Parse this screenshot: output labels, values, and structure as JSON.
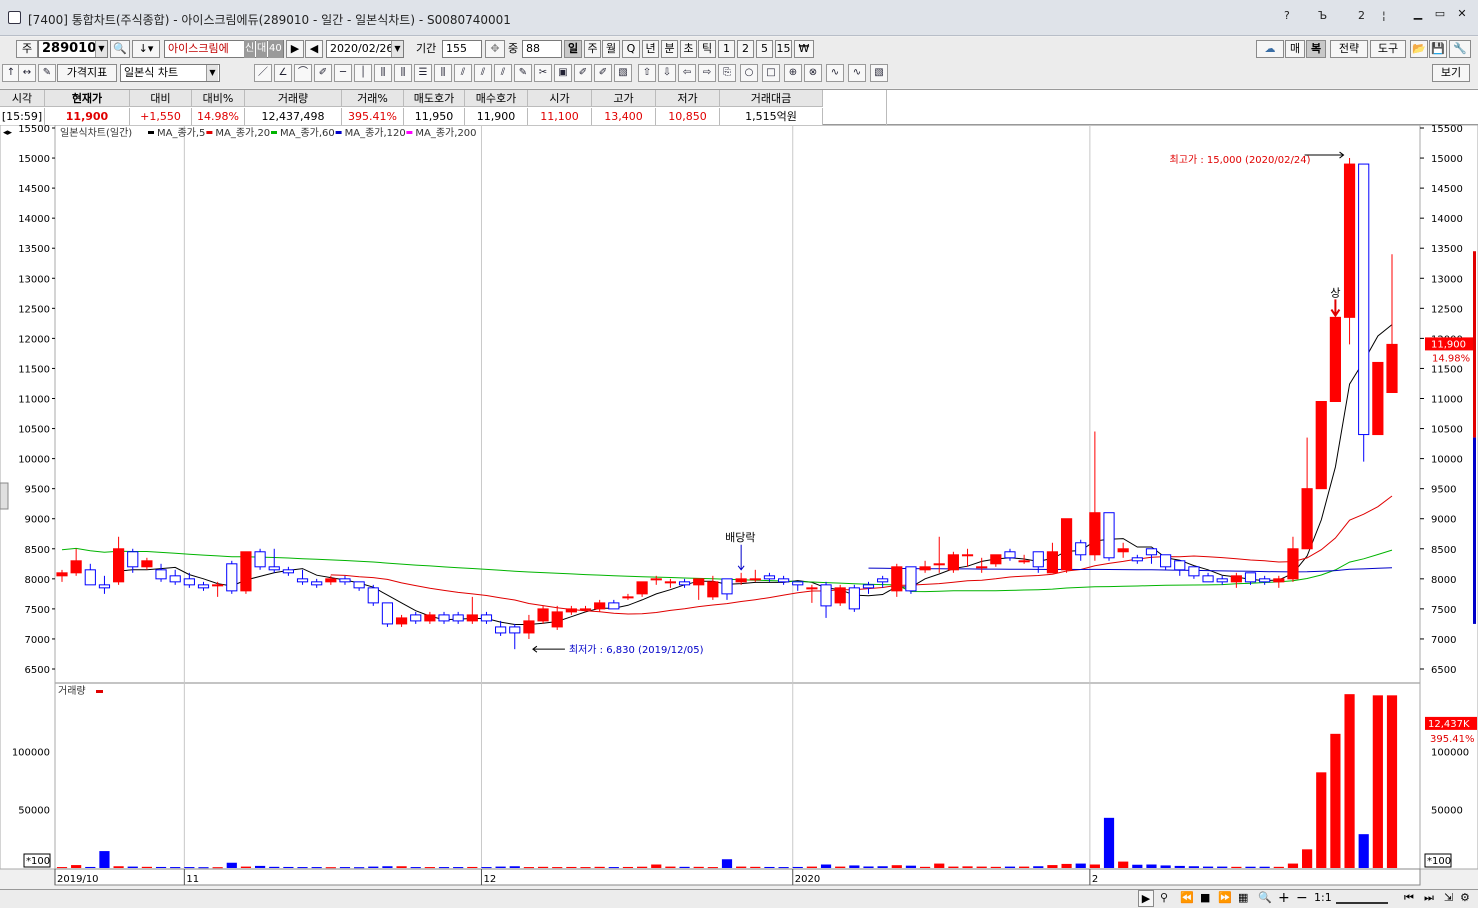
{
  "window": {
    "title": "[7400] 통합차트(주식종합) - 아이스크림에듀(289010 - 일간 - 일본식차트) - S0080740001",
    "controls": [
      "?",
      "Ъ",
      "2",
      "¦"
    ]
  },
  "toolbar1": {
    "market_prefix": "주",
    "code": "289010",
    "stock_name": "아이스크림에",
    "stock_tags": [
      "신",
      "대",
      "40"
    ],
    "date": "2020/02/26",
    "period_label": "기간",
    "period_value": "155",
    "mid_label": "중",
    "mid_value": "88",
    "timeframes": [
      "일",
      "주",
      "월",
      "Q",
      "년",
      "분",
      "초",
      "틱",
      "1",
      "2",
      "5",
      "15",
      "₩"
    ],
    "selected_timeframe": "일",
    "right_buttons": [
      "매",
      "복",
      "전략",
      "도구"
    ]
  },
  "toolbar2": {
    "indicator_btn": "가격지표",
    "chart_type": "일본식 차트",
    "view_btn": "보기"
  },
  "quote": {
    "headers": [
      "시각",
      "현재가",
      "대비",
      "대비%",
      "거래량",
      "거래%",
      "매도호가",
      "매수호가",
      "시가",
      "고가",
      "저가",
      "거래대금"
    ],
    "values": [
      "[15:59]",
      "11,900",
      "+1,550",
      "14.98%",
      "12,437,498",
      "395.41%",
      "11,950",
      "11,900",
      "11,100",
      "13,400",
      "10,850",
      "1,515억원"
    ]
  },
  "chart": {
    "legend_title": "일본식차트(일간)",
    "ma_legend": [
      {
        "label": "MA_종가,5",
        "color": "#000000"
      },
      {
        "label": "MA_종가,20",
        "color": "#e00000"
      },
      {
        "label": "MA_종가,60",
        "color": "#00b400"
      },
      {
        "label": "MA_종가,120",
        "color": "#0000c8"
      },
      {
        "label": "MA_종가,200",
        "color": "#ff00ff"
      }
    ],
    "price_ticks": [
      "15500",
      "15000",
      "14500",
      "14000",
      "13500",
      "13000",
      "12500",
      "12000",
      "11500",
      "11000",
      "10500",
      "10000",
      "9500",
      "9000",
      "8500",
      "8000",
      "7500",
      "7000",
      "6500"
    ],
    "volume_label": "거래량",
    "volume_ticks": [
      "100000",
      "50000"
    ],
    "volume_unit": "*100",
    "x_labels": [
      "2019/10",
      "11",
      "12",
      "2020",
      "2"
    ],
    "annotations": {
      "high": "최고가 : 15,000 (2020/02/24)",
      "low": "최저가 : 6,830 (2019/12/05)",
      "dividend": "배당락",
      "upper_limit": "상"
    },
    "current_price_tag": "11,900",
    "current_pct_tag": "14.98%",
    "current_volume_tag": "12,437K",
    "current_volume_pct": "395.41%"
  },
  "chart_data": {
    "type": "candlestick",
    "open": [
      8050,
      8100,
      8150,
      7900,
      7950,
      8450,
      8200,
      8150,
      8050,
      8000,
      7900,
      7900,
      8250,
      7800,
      8450,
      8200,
      8150,
      8000,
      7950,
      7950,
      8000,
      7950,
      7850,
      7600,
      7250,
      7400,
      7300,
      7400,
      7400,
      7300,
      7400,
      7200,
      7200,
      7100,
      7300,
      7200,
      7450,
      7500,
      7500,
      7600,
      7700,
      7750,
      8000,
      7950,
      7950,
      7900,
      7700,
      8000,
      7950,
      8000,
      8050,
      8000,
      7950,
      7850,
      7900,
      7600,
      7850,
      7900,
      8000,
      7800,
      8200,
      8150,
      8250,
      8150,
      8400,
      8200,
      8250,
      8450,
      8300,
      8450,
      8100,
      8150,
      8600,
      8400,
      9100,
      8450,
      8350,
      8500,
      8400,
      8300,
      8200,
      8050,
      8000,
      7950,
      8100,
      8000,
      7950,
      8000,
      8500,
      9500,
      10950,
      12350,
      14900,
      10400,
      11100
    ],
    "close": [
      8100,
      8300,
      7900,
      7850,
      8500,
      8200,
      8300,
      8000,
      7950,
      7900,
      7850,
      7900,
      7800,
      8450,
      8200,
      8150,
      8100,
      7950,
      7900,
      8000,
      7950,
      7850,
      7600,
      7250,
      7350,
      7300,
      7400,
      7300,
      7300,
      7400,
      7300,
      7100,
      7100,
      7300,
      7500,
      7450,
      7500,
      7500,
      7600,
      7500,
      7700,
      7950,
      8000,
      7950,
      7900,
      8000,
      7950,
      7750,
      8000,
      8000,
      8000,
      7950,
      7900,
      7850,
      7550,
      7850,
      7500,
      7850,
      7950,
      8200,
      7800,
      8200,
      8250,
      8400,
      8400,
      8200,
      8400,
      8350,
      8300,
      8200,
      8450,
      9000,
      8400,
      9100,
      8350,
      8500,
      8300,
      8400,
      8200,
      8150,
      8050,
      7950,
      7950,
      8050,
      7950,
      7950,
      8000,
      8500,
      9500,
      10950,
      12350,
      14900,
      10400,
      11600,
      11900
    ],
    "high": [
      8150,
      8500,
      8250,
      8050,
      8700,
      8500,
      8350,
      8250,
      8150,
      8100,
      7950,
      7950,
      8300,
      8000,
      8500,
      8500,
      8200,
      8150,
      8000,
      8050,
      8050,
      7950,
      7900,
      7600,
      7400,
      7450,
      7450,
      7450,
      7450,
      7700,
      7450,
      7300,
      7250,
      7400,
      7550,
      7550,
      7550,
      7550,
      7650,
      7650,
      7750,
      7950,
      8050,
      8000,
      8000,
      8000,
      8050,
      8000,
      8100,
      8150,
      8100,
      8050,
      7950,
      7900,
      7950,
      7900,
      7900,
      7950,
      8050,
      8250,
      8200,
      8300,
      8700,
      8450,
      8500,
      8350,
      8400,
      8500,
      8400,
      8450,
      8600,
      9000,
      8650,
      10450,
      8450,
      8600,
      8400,
      8450,
      8400,
      8300,
      8200,
      8100,
      8050,
      8100,
      8100,
      8050,
      8050,
      8700,
      10350,
      10950,
      12350,
      15000,
      11000,
      11600,
      13400
    ],
    "low": [
      7950,
      8050,
      7900,
      7750,
      7900,
      8100,
      8150,
      7950,
      7900,
      7850,
      7800,
      7700,
      7750,
      7750,
      8150,
      8100,
      8050,
      7900,
      7850,
      7900,
      7900,
      7800,
      7550,
      7200,
      7200,
      7250,
      7250,
      7250,
      7250,
      7250,
      7250,
      7050,
      6830,
      7000,
      7250,
      7150,
      7400,
      7450,
      7450,
      7500,
      7650,
      7700,
      7900,
      7850,
      7850,
      7650,
      7650,
      7650,
      7900,
      7950,
      7950,
      7900,
      7800,
      7600,
      7350,
      7550,
      7450,
      7750,
      7850,
      7700,
      7750,
      8100,
      8100,
      8100,
      8200,
      8100,
      8200,
      8300,
      8250,
      8100,
      8100,
      8100,
      8300,
      8300,
      8300,
      8350,
      8250,
      8250,
      8150,
      8050,
      8000,
      7950,
      7900,
      7850,
      7900,
      7900,
      7850,
      7950,
      8500,
      9500,
      10950,
      11900,
      9950,
      10850,
      11100
    ],
    "volume": [
      800,
      2500,
      900,
      14500,
      1500,
      1200,
      1000,
      900,
      800,
      800,
      700,
      700,
      4500,
      1200,
      1800,
      1000,
      900,
      800,
      800,
      700,
      800,
      700,
      1200,
      1500,
      1500,
      800,
      800,
      800,
      800,
      900,
      800,
      1200,
      1500,
      800,
      1000,
      800,
      900,
      800,
      1000,
      800,
      900,
      1100,
      3000,
      1200,
      1000,
      1000,
      800,
      7500,
      1200,
      1000,
      900,
      800,
      900,
      1200,
      3000,
      1200,
      2200,
      1300,
      1500,
      2400,
      2000,
      1000,
      3800,
      1200,
      1400,
      1200,
      1000,
      1200,
      1200,
      1500,
      2500,
      3500,
      3800,
      3000,
      43000,
      5500,
      2800,
      3000,
      2200,
      1800,
      1500,
      1200,
      1200,
      1000,
      1100,
      1100,
      1000,
      3800,
      16000,
      82000,
      115000,
      149000,
      29000,
      148000,
      148000
    ],
    "ylim": [
      6500,
      15500
    ],
    "x_labels": [
      "2019/10",
      "11",
      "12",
      "2020",
      "2"
    ]
  },
  "bottom": {
    "ratio_label": "1:1"
  }
}
